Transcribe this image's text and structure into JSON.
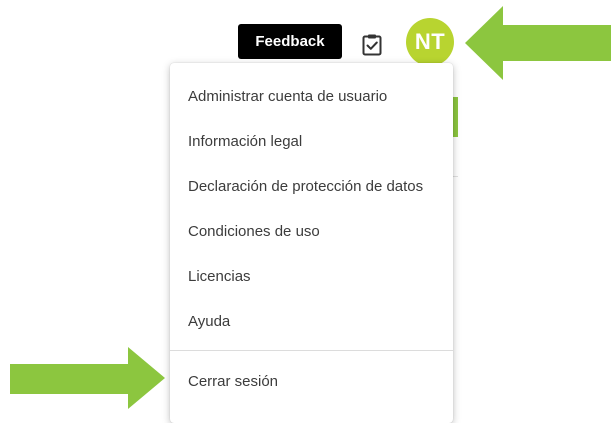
{
  "header": {
    "feedback_label": "Feedback",
    "clipboard_icon": "clipboard-check-icon",
    "avatar_initials": "NT",
    "avatar_color": "#b8d430"
  },
  "user_menu": {
    "items": [
      {
        "label": "Administrar cuenta de usuario"
      },
      {
        "label": "Información legal"
      },
      {
        "label": "Declaración de protección de datos"
      },
      {
        "label": "Condiciones de uso"
      },
      {
        "label": "Licencias"
      },
      {
        "label": "Ayuda"
      }
    ],
    "logout_label": "Cerrar sesión"
  },
  "annotations": {
    "arrow_color": "#8cc63f",
    "arrow_icon": "left-pointing-arrow"
  }
}
